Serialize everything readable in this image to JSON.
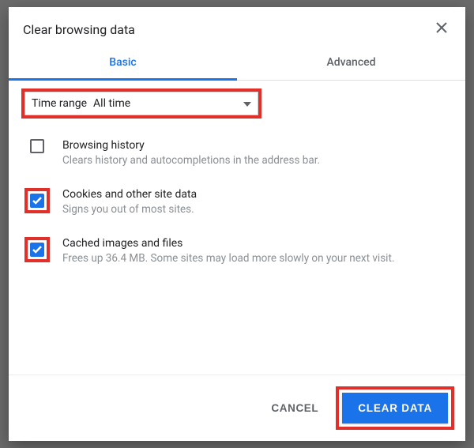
{
  "dialog": {
    "title": "Clear browsing data"
  },
  "tabs": {
    "basic": "Basic",
    "advanced": "Advanced"
  },
  "time": {
    "label": "Time range",
    "value": "All time"
  },
  "options": {
    "history": {
      "title": "Browsing history",
      "desc": "Clears history and autocompletions in the address bar.",
      "checked": false
    },
    "cookies": {
      "title": "Cookies and other site data",
      "desc": "Signs you out of most sites.",
      "checked": true
    },
    "cache": {
      "title": "Cached images and files",
      "desc": "Frees up 36.4 MB. Some sites may load more slowly on your next visit.",
      "checked": true
    }
  },
  "buttons": {
    "cancel": "CANCEL",
    "clear": "CLEAR DATA"
  }
}
